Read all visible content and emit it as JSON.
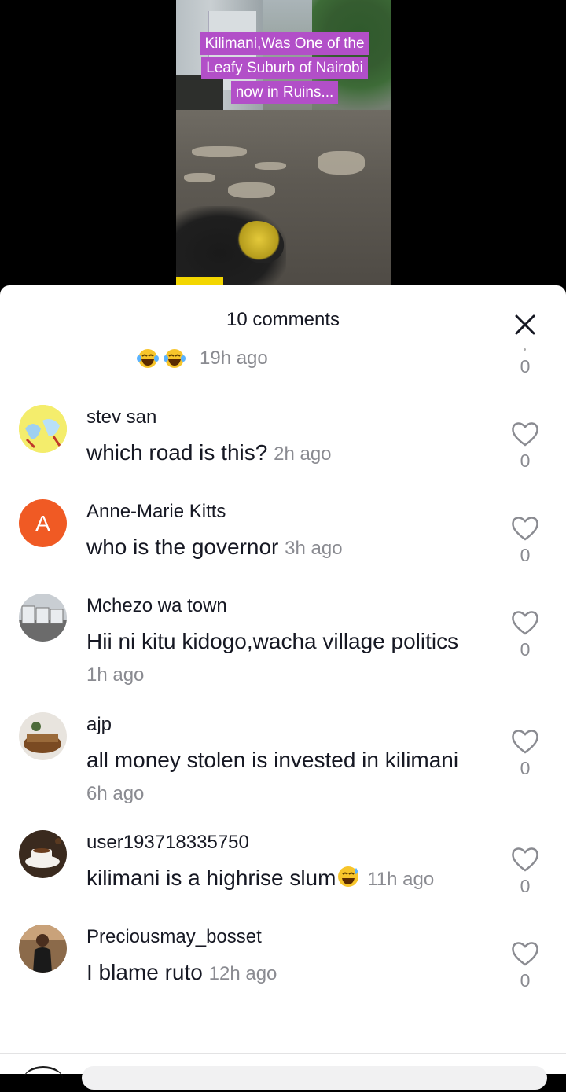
{
  "video": {
    "caption_lines": [
      "Kilimani,Was One of the",
      "Leafy Suburb of Nairobi",
      "now in Ruins..."
    ]
  },
  "sheet": {
    "title": "10 comments",
    "partial_comment": {
      "time": "19h ago",
      "likes": "0"
    }
  },
  "comments": [
    {
      "username": "stev san",
      "text": "which road is this?",
      "time": "2h ago",
      "likes": "0"
    },
    {
      "username": "Anne-Marie Kitts",
      "avatar_letter": "A",
      "text": "who is the governor",
      "time": "3h ago",
      "likes": "0"
    },
    {
      "username": "Mchezo wa town",
      "text": "Hii ni kitu kidogo,wacha village politics",
      "time": "1h ago",
      "likes": "0"
    },
    {
      "username": "ajp",
      "text": "all money stolen is invested in kilimani",
      "time": "6h ago",
      "likes": "0"
    },
    {
      "username": "user193718335750",
      "text": "kilimani is a highrise slum",
      "time": "11h ago",
      "likes": "0"
    },
    {
      "username": "Preciousmay_bosset",
      "text": "I blame ruto",
      "time": "12h ago",
      "likes": "0"
    }
  ],
  "colors": {
    "overlay": "#b24fc8",
    "avatar_orange": "#f05a24",
    "muted": "#8a8b91"
  }
}
